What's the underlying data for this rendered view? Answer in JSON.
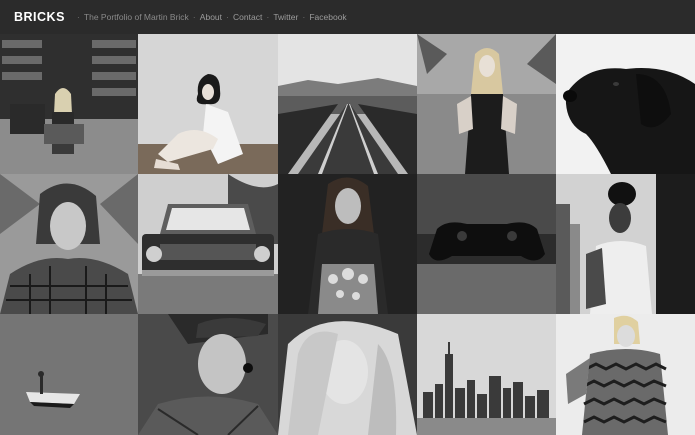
{
  "header": {
    "brand": "BRICKS",
    "tagline": "The Portfolio of Martin Brick",
    "nav": [
      {
        "label": "About"
      },
      {
        "label": "Contact"
      },
      {
        "label": "Twitter"
      },
      {
        "label": "Facebook"
      }
    ],
    "separator": "·"
  },
  "gallery": {
    "tiles": [
      {
        "subject": "woman-in-library"
      },
      {
        "subject": "woman-seated-studio"
      },
      {
        "subject": "railway-bridge"
      },
      {
        "subject": "blonde-woman-outdoors"
      },
      {
        "subject": "black-labrador"
      },
      {
        "subject": "woman-plaid-scarf"
      },
      {
        "subject": "classic-car"
      },
      {
        "subject": "woman-patterned-dress"
      },
      {
        "subject": "game-controller"
      },
      {
        "subject": "woman-city-backdrop"
      },
      {
        "subject": "boat-on-water"
      },
      {
        "subject": "man-with-cap"
      },
      {
        "subject": "blonde-woman-closeup"
      },
      {
        "subject": "city-skyline"
      },
      {
        "subject": "woman-zigzag-sweater"
      }
    ]
  },
  "colors": {
    "header_bg": "#2b2b2b",
    "brand": "#ffffff",
    "nav_text": "#9b9b9b"
  }
}
